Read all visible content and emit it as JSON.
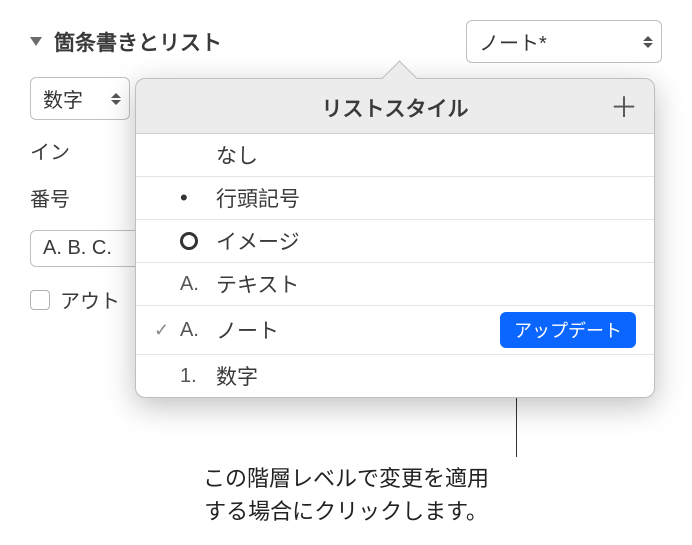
{
  "section": {
    "title": "箇条書きとリスト"
  },
  "mainDropdown": {
    "value": "ノート*"
  },
  "typeDropdown": {
    "value": "数字"
  },
  "labels": {
    "indent": "イン",
    "number": "番号",
    "outline": "アウト"
  },
  "abcField": {
    "value": "A. B. C."
  },
  "popover": {
    "title": "リストスタイル",
    "items": [
      {
        "prefix": "",
        "label": "なし"
      },
      {
        "prefix": "bullet",
        "label": "行頭記号"
      },
      {
        "prefix": "circle",
        "label": "イメージ"
      },
      {
        "prefix": "A.",
        "label": "テキスト"
      },
      {
        "prefix": "A.",
        "label": "ノート",
        "selected": true
      },
      {
        "prefix": "1.",
        "label": "数字"
      }
    ],
    "updateBtn": "アップデート"
  },
  "callout": {
    "line1": "この階層レベルで変更を適用",
    "line2": "する場合にクリックします。"
  }
}
